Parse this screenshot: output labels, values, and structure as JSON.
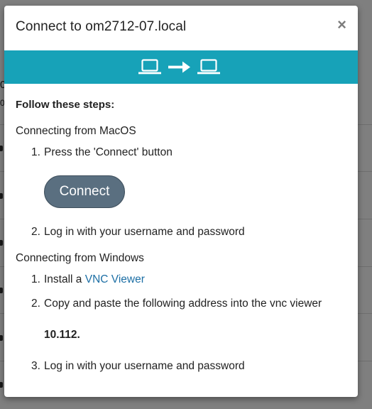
{
  "modal": {
    "title": "Connect to om2712-07.local",
    "close_glyph": "×",
    "banner_color": "#17a2b8",
    "banner_icons": [
      "laptop-icon",
      "arrow-right-icon",
      "laptop-icon"
    ]
  },
  "body": {
    "intro": "Follow these steps:",
    "macos": {
      "heading": "Connecting from MacOS",
      "step1_num": "1.",
      "step1_text": "Press the 'Connect' button",
      "connect_button": "Connect",
      "step2_num": "2.",
      "step2_text": "Log in with your username and password"
    },
    "windows": {
      "heading": "Connecting from Windows",
      "step1_num": "1.",
      "step1_prefix": "Install a ",
      "step1_link": "VNC Viewer",
      "step2_num": "2.",
      "step2_text": "Copy and paste the following address into the vnc viewer",
      "address": "10.112.",
      "step3_num": "3.",
      "step3_text": "Log in with your username and password"
    }
  },
  "background": {
    "glyphs": [
      "0",
      "0"
    ]
  }
}
